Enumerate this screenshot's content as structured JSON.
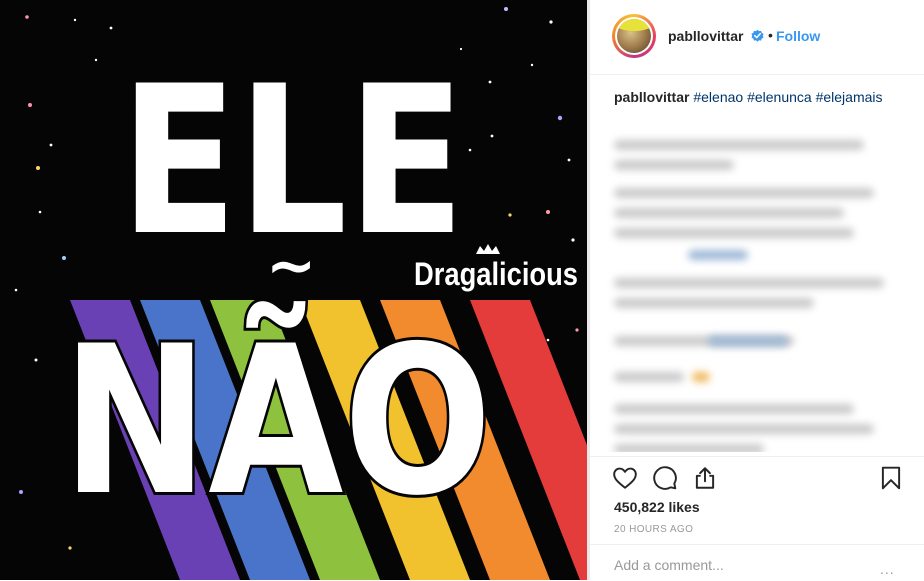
{
  "image": {
    "line1": "ELE",
    "tilde": "~",
    "line2": "NÃO",
    "watermark": "Dragalicious",
    "colors": {
      "background": "#050505",
      "rainbow": [
        "#6a41b5",
        "#4a74c9",
        "#8ec13d",
        "#f2c12e",
        "#f28a2e",
        "#e43b3b"
      ]
    }
  },
  "header": {
    "username": "pabllovittar",
    "separator": "•",
    "follow_label": "Follow",
    "verified_icon": "verified-badge-icon",
    "accent_color": "#3897f0"
  },
  "caption": {
    "username": "pabllovittar",
    "hashtags": "#elenao #elenunca #elejamais"
  },
  "actions": {
    "icons": [
      "heart-icon",
      "comment-icon",
      "share-icon",
      "bookmark-icon"
    ]
  },
  "likes_text": "450,822 likes",
  "timestamp": "20 HOURS AGO",
  "comment": {
    "placeholder": "Add a comment...",
    "more_label": "..."
  }
}
